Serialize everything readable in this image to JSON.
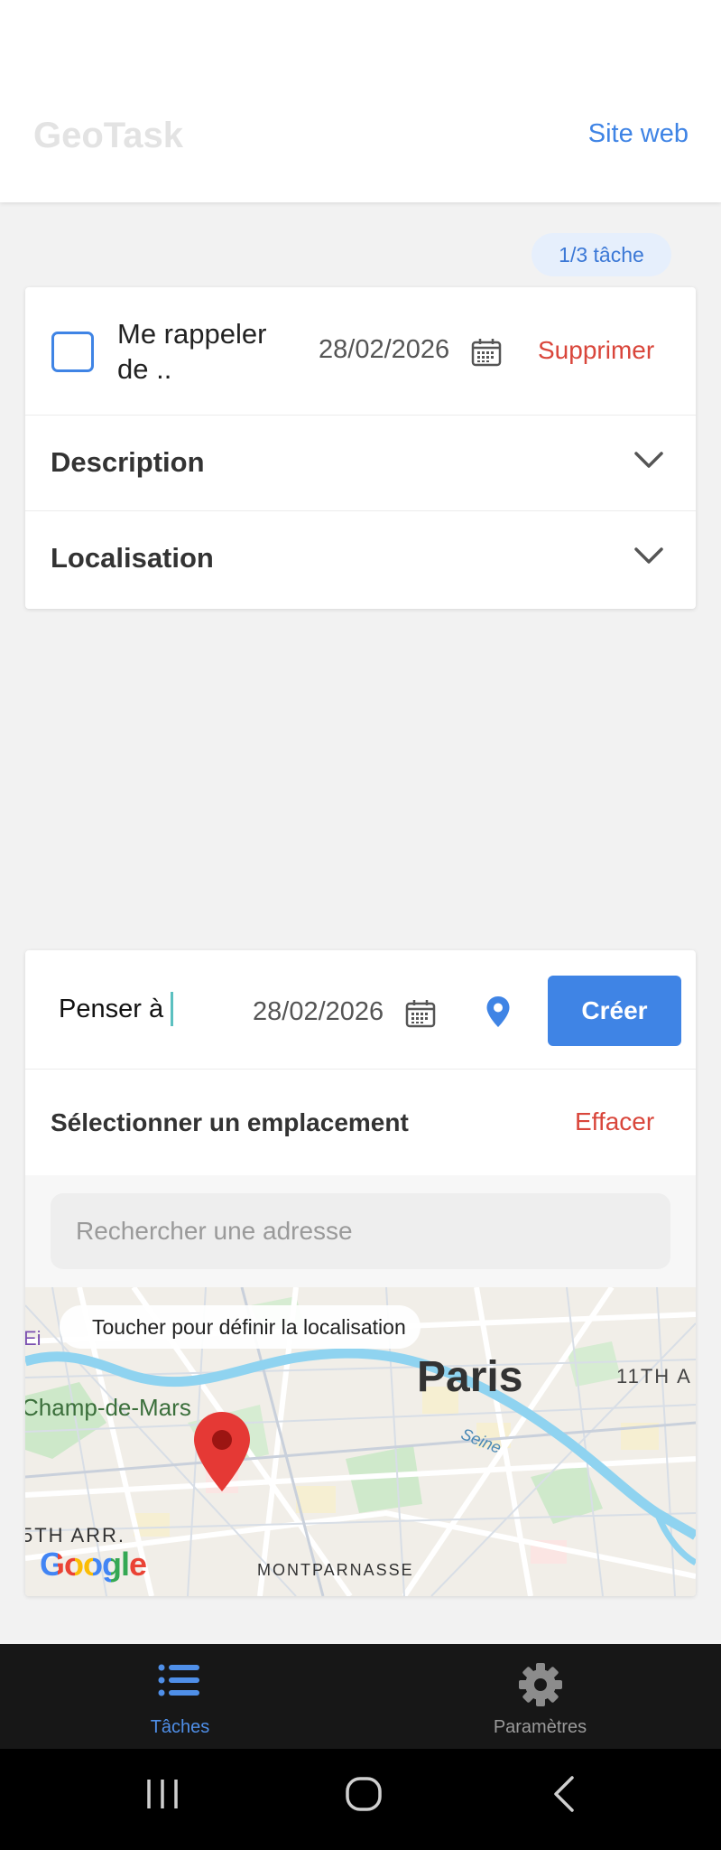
{
  "header": {
    "app_title": "GeoTask",
    "site_link": "Site web"
  },
  "badge": {
    "count_label": "1/3 tâche"
  },
  "task": {
    "checked": false,
    "title": "Me rappeler de ..",
    "date": "28/02/2026",
    "delete_label": "Supprimer",
    "sections": [
      {
        "label": "Description"
      },
      {
        "label": "Localisation"
      }
    ]
  },
  "new_task": {
    "input_value": "Penser à",
    "date": "28/02/2026",
    "create_label": "Créer",
    "location_title": "Sélectionner un emplacement",
    "clear_label": "Effacer",
    "search_placeholder": "Rechercher une adresse"
  },
  "map": {
    "tooltip": "Toucher pour définir la localisation",
    "labels": {
      "city": "Paris",
      "district_11": "11TH A",
      "champ": "Champ-de-Mars",
      "river": "Seine",
      "district_15": "5TH ARR.",
      "montparnasse": "MONTPARNASSE",
      "eiffel": "Ei"
    },
    "attribution": "Google"
  },
  "bottom_nav": {
    "tasks_label": "Tâches",
    "settings_label": "Paramètres"
  },
  "colors": {
    "accent": "#3f84e5",
    "danger": "#d9463b",
    "marker": "#e53935"
  },
  "icons": {
    "calendar": "calendar-icon",
    "chevron": "chevron-down-icon",
    "pin": "location-pin-icon",
    "list": "list-icon",
    "gear": "gear-icon"
  }
}
